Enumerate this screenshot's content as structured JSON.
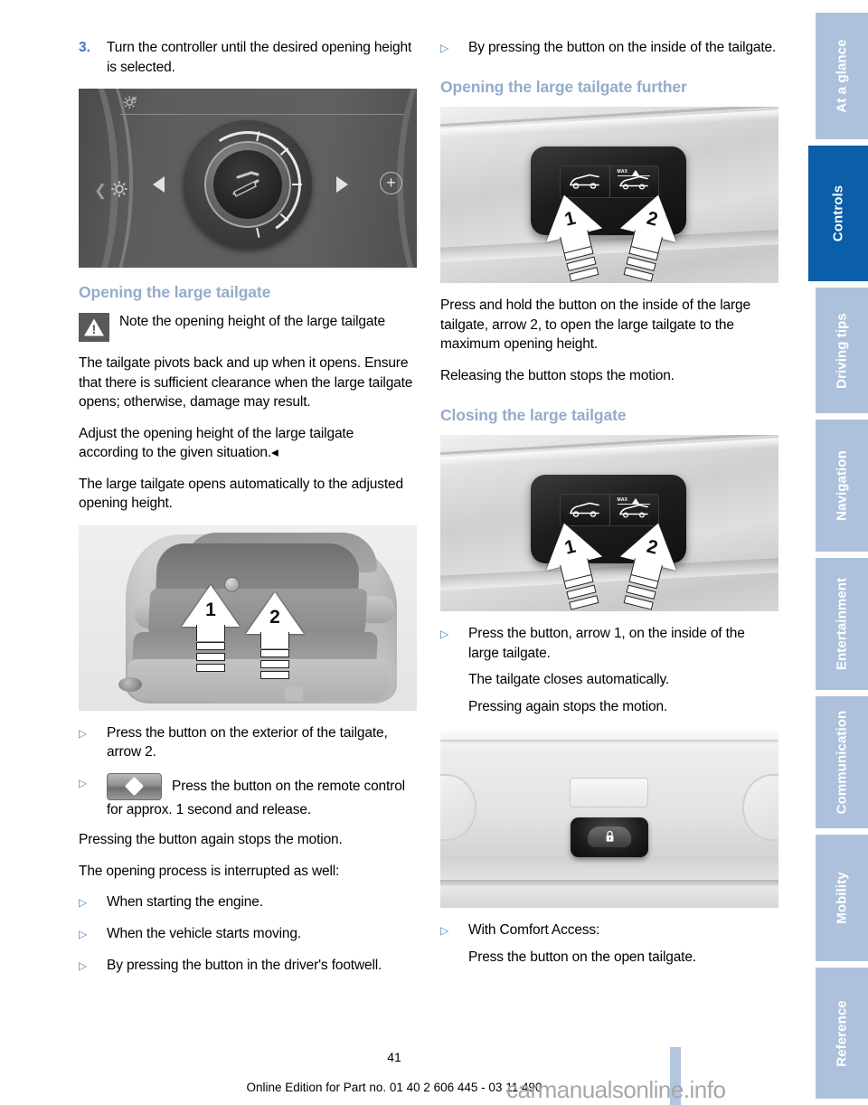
{
  "document": {
    "page_number": "41",
    "footer": "Online Edition for Part no. 01 40 2 606 445 - 03 11 490",
    "watermark": "carmanualsonline.info"
  },
  "left_column": {
    "step": {
      "number": "3.",
      "text": "Turn the controller until the desired opening height is selected."
    },
    "figure_idrive": {
      "caption_alt": "iDrive controller screen with rotary dial",
      "gear_icon": "gear-icon",
      "left_arrow": "◀",
      "right_arrow": "▶",
      "plus": "+"
    },
    "heading_opening": "Opening the large tailgate",
    "note": {
      "icon": "warning-triangle-icon",
      "title": "Note the opening height of the large tailgate",
      "body_1": "The tailgate pivots back and up when it opens. Ensure that there is sufficient clearance when the large tailgate opens; otherwise, damage may result.",
      "body_2": "Adjust the opening height of the large tailgate according to the given situation.◂"
    },
    "para_auto": "The large tailgate opens automatically to the adjusted opening height.",
    "figure_car_rear": {
      "caption_alt": "Rear of vehicle showing tailgate buttons",
      "arrow_1": "1",
      "arrow_2": "2"
    },
    "bullets": [
      {
        "mark": "▷",
        "text": "Press the button on the exterior of the tailgate, arrow 2."
      },
      {
        "mark": "▷",
        "icon": "remote-control-key-icon",
        "text": "Press the button on the remote control for approx. 1 second and release."
      }
    ],
    "para_stop": "Pressing the button again stops the motion.",
    "para_interrupt": "The opening process is interrupted as well:",
    "interrupt_bullets": [
      {
        "mark": "▷",
        "text": "When starting the engine."
      },
      {
        "mark": "▷",
        "text": "When the vehicle starts moving."
      },
      {
        "mark": "▷",
        "text": "By pressing the button in the driver's footwell."
      }
    ]
  },
  "right_column": {
    "top_bullet": {
      "mark": "▷",
      "text": "By pressing the button on the inside of the tailgate."
    },
    "heading_further": "Opening the large tailgate further",
    "figure_panel_1": {
      "caption_alt": "Tailgate inner button panel",
      "arrow_1": "1",
      "arrow_2": "2",
      "max_label": "MAX"
    },
    "para_press_hold": "Press and hold the button on the inside of the large tailgate, arrow 2, to open the large tailgate to the maximum opening height.",
    "para_release": "Releasing the button stops the motion.",
    "heading_closing": "Closing the large tailgate",
    "figure_panel_2": {
      "caption_alt": "Tailgate inner button panel",
      "arrow_1": "1",
      "arrow_2": "2",
      "max_label": "MAX"
    },
    "bullet_close": {
      "mark": "▷",
      "text": "Press the button, arrow 1, on the inside of the large tailgate.",
      "sub_1": "The tailgate closes automatically.",
      "sub_2": "Pressing again stops the motion."
    },
    "figure_close_button": {
      "caption_alt": "Open tailgate with close button",
      "icon": "lock-icon"
    },
    "bullet_comfort": {
      "mark": "▷",
      "text": "With Comfort Access:",
      "sub_1": "Press the button on the open tailgate."
    }
  },
  "sidebar": {
    "active_index": 1,
    "tabs": [
      {
        "label": "At a glance"
      },
      {
        "label": "Controls"
      },
      {
        "label": "Driving tips"
      },
      {
        "label": "Navigation"
      },
      {
        "label": "Entertainment"
      },
      {
        "label": "Communication"
      },
      {
        "label": "Mobility"
      },
      {
        "label": "Reference"
      }
    ]
  },
  "colors": {
    "heading_blue": "#94abcb",
    "step_number_blue": "#3a7bbf",
    "bullet_blue": "#4a86c0",
    "tab_inactive": "#aec1dc",
    "tab_active": "#0b5ea8",
    "watermark_gray": "#a7a7a7"
  }
}
